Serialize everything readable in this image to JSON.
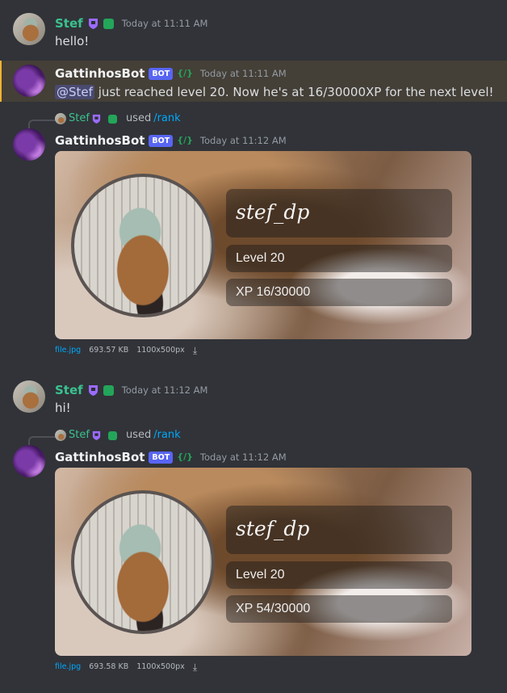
{
  "colors": {
    "background": "#313338",
    "stef_name": "#3ac28f",
    "bot_tag": "#5865f2",
    "mention_highlight": "#f0b232",
    "command_link": "#00a8fc"
  },
  "messages": [
    {
      "author": "Stef",
      "timestamp": "Today at 11:11 AM",
      "text": "hello!"
    },
    {
      "author": "GattinhosBot",
      "bot_tag": "BOT",
      "slash_badge": "{/}",
      "timestamp": "Today at 11:11 AM",
      "mention": "@Stef",
      "text": " just reached level 20. Now he's at 16/30000XP for the next level!"
    },
    {
      "reply": {
        "name": "Stef",
        "used": "used",
        "command": "/rank"
      },
      "author": "GattinhosBot",
      "bot_tag": "BOT",
      "slash_badge": "{/}",
      "timestamp": "Today at 11:12 AM",
      "card": {
        "username": "stef_dp",
        "level": "Level 20",
        "xp": "XP 16/30000"
      },
      "file": {
        "name": "file.jpg",
        "size": "693.57 KB",
        "dims": "1100x500px"
      }
    },
    {
      "author": "Stef",
      "timestamp": "Today at 11:12 AM",
      "text": "hi!"
    },
    {
      "reply": {
        "name": "Stef",
        "used": "used",
        "command": "/rank"
      },
      "author": "GattinhosBot",
      "bot_tag": "BOT",
      "slash_badge": "{/}",
      "timestamp": "Today at 11:12 AM",
      "card": {
        "username": "stef_dp",
        "level": "Level 20",
        "xp": "XP 54/30000"
      },
      "file": {
        "name": "file.jpg",
        "size": "693.58 KB",
        "dims": "1100x500px"
      }
    }
  ]
}
